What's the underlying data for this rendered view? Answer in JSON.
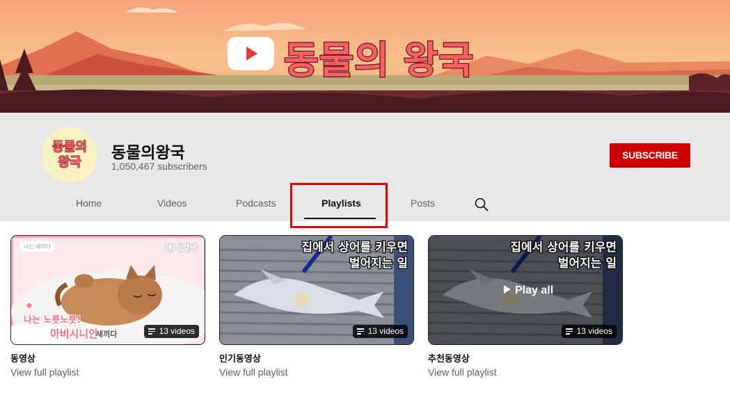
{
  "banner": {
    "title": "동물의 왕국"
  },
  "channel": {
    "avatar_text_line1": "동물의",
    "avatar_text_line2": "왕국",
    "name": "동물의왕국",
    "subscribers": "1,050,467 subscribers",
    "subscribe_label": "SUBSCRIBE",
    "subscribe_color": "#cc0000"
  },
  "tabs": [
    {
      "label": "Home"
    },
    {
      "label": "Videos"
    },
    {
      "label": "Podcasts"
    },
    {
      "label": "Playlists",
      "active": true
    },
    {
      "label": "Posts"
    }
  ],
  "highlight_color": "#e00000",
  "playlists": [
    {
      "title": "동영상",
      "link": "View full playlist",
      "count": "13 videos",
      "thumb": {
        "tag_top_left": "나는 새끼다",
        "tag_top_right": "애니멀봐",
        "line1": "나는 노릇노릇!",
        "line2": "아비시니안",
        "line3": "새끼다"
      }
    },
    {
      "title": "인기동영상",
      "link": "View full playlist",
      "count": "13 videos",
      "thumb": {
        "line1": "집에서 상어를 키우면",
        "line2": "벌어지는 일"
      }
    },
    {
      "title": "추천동영상",
      "link": "View full playlist",
      "count": "13 videos",
      "play_all": "Play all",
      "thumb": {
        "line1": "집에서 상어를 키우면",
        "line2": "벌어지는 일"
      }
    }
  ]
}
